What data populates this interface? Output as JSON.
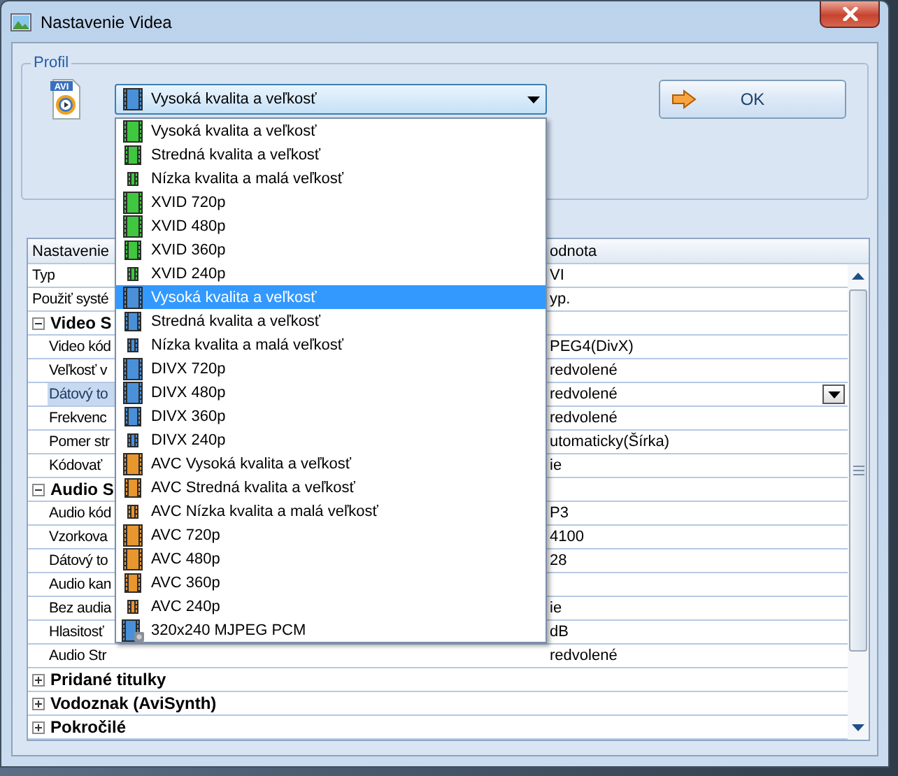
{
  "window": {
    "title": "Nastavenie Videa"
  },
  "profile": {
    "legend": "Profil",
    "icon_label": "AVI",
    "combo_value": "Vysoká kvalita a veľkosť",
    "ok_button": "OK",
    "options": [
      {
        "label": "Vysoká kvalita a veľkosť",
        "kind": "large",
        "color": "#3fc83f",
        "selected": false
      },
      {
        "label": "Stredná kvalita a veľkosť",
        "kind": "medium",
        "color": "#3fc83f",
        "selected": false
      },
      {
        "label": "Nízka kvalita a malá veľkosť",
        "kind": "small",
        "color": "#3fc83f",
        "selected": false
      },
      {
        "label": "XVID 720p",
        "kind": "large",
        "color": "#3fc83f",
        "selected": false
      },
      {
        "label": "XVID 480p",
        "kind": "large",
        "color": "#3fc83f",
        "selected": false
      },
      {
        "label": "XVID 360p",
        "kind": "medium",
        "color": "#3fc83f",
        "selected": false
      },
      {
        "label": "XVID 240p",
        "kind": "small",
        "color": "#3fc83f",
        "selected": false
      },
      {
        "label": "Vysoká kvalita a veľkosť",
        "kind": "large",
        "color": "#4a90d9",
        "selected": true
      },
      {
        "label": "Stredná kvalita a veľkosť",
        "kind": "medium",
        "color": "#4a90d9",
        "selected": false
      },
      {
        "label": "Nízka kvalita a malá veľkosť",
        "kind": "small",
        "color": "#4a90d9",
        "selected": false
      },
      {
        "label": "DIVX 720p",
        "kind": "large",
        "color": "#4a90d9",
        "selected": false
      },
      {
        "label": "DIVX 480p",
        "kind": "large",
        "color": "#4a90d9",
        "selected": false
      },
      {
        "label": "DIVX 360p",
        "kind": "medium",
        "color": "#4a90d9",
        "selected": false
      },
      {
        "label": "DIVX 240p",
        "kind": "small",
        "color": "#4a90d9",
        "selected": false
      },
      {
        "label": "AVC Vysoká kvalita a veľkosť",
        "kind": "large",
        "color": "#e8962e",
        "selected": false
      },
      {
        "label": "AVC Stredná kvalita a veľkosť",
        "kind": "medium",
        "color": "#e8962e",
        "selected": false
      },
      {
        "label": "AVC Nízka kvalita a malá veľkosť",
        "kind": "small",
        "color": "#e8962e",
        "selected": false
      },
      {
        "label": "AVC 720p",
        "kind": "large",
        "color": "#e8962e",
        "selected": false
      },
      {
        "label": "AVC 480p",
        "kind": "large",
        "color": "#e8962e",
        "selected": false
      },
      {
        "label": "AVC 360p",
        "kind": "medium",
        "color": "#e8962e",
        "selected": false
      },
      {
        "label": "AVC 240p",
        "kind": "small",
        "color": "#e8962e",
        "selected": false
      },
      {
        "label": "320x240 MJPEG PCM",
        "kind": "camera",
        "color": "#4a90d9",
        "selected": false
      }
    ]
  },
  "settings": {
    "columns": [
      "Nastavenie",
      "odnota"
    ],
    "rows": [
      {
        "kind": "property",
        "name": "Typ",
        "value": "VI",
        "selected": false
      },
      {
        "kind": "property",
        "name": "Použiť systé",
        "value": "yp.",
        "selected": false
      },
      {
        "kind": "group",
        "name": "Video S",
        "expanded": true,
        "children": [
          {
            "kind": "property",
            "name": "Video kód",
            "value": "PEG4(DivX)",
            "selected": false
          },
          {
            "kind": "property",
            "name": "Veľkosť v",
            "value": "redvolené",
            "selected": false
          },
          {
            "kind": "property",
            "name": "Dátový to",
            "value": "redvolené",
            "selected": true
          },
          {
            "kind": "property",
            "name": "Frekvenc",
            "value": "redvolené",
            "selected": false
          },
          {
            "kind": "property",
            "name": "Pomer str",
            "value": "utomaticky(Šírka)",
            "selected": false
          },
          {
            "kind": "property",
            "name": "Kódovať",
            "value": "ie",
            "selected": false
          }
        ]
      },
      {
        "kind": "group",
        "name": "Audio S",
        "expanded": true,
        "children": [
          {
            "kind": "property",
            "name": "Audio kód",
            "value": "P3",
            "selected": false
          },
          {
            "kind": "property",
            "name": "Vzorkova",
            "value": "4100",
            "selected": false
          },
          {
            "kind": "property",
            "name": "Dátový to",
            "value": "28",
            "selected": false
          },
          {
            "kind": "property",
            "name": "Audio kan",
            "selected": false
          },
          {
            "kind": "property",
            "name": "Bez audia",
            "value": "ie",
            "selected": false
          },
          {
            "kind": "property",
            "name": "Hlasitosť",
            "value": "dB",
            "selected": false
          },
          {
            "kind": "property",
            "name": "Audio Str",
            "value": "redvolené",
            "selected": false
          }
        ]
      },
      {
        "kind": "group",
        "name": "Pridané titulky",
        "expanded": false
      },
      {
        "kind": "group",
        "name": "Vodoznak (AviSynth)",
        "expanded": false
      },
      {
        "kind": "group",
        "name": "Pokročilé",
        "expanded": false
      }
    ]
  }
}
